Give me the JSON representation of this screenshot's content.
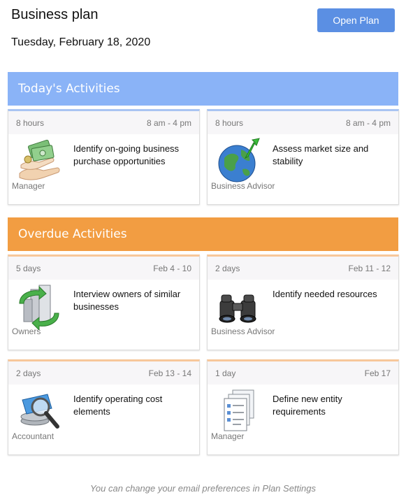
{
  "header": {
    "title": "Business plan",
    "date": "Tuesday, February 18, 2020",
    "open_button_label": "Open Plan"
  },
  "sections": {
    "today": {
      "label": "Today's Activities",
      "color": "#8ab3f7"
    },
    "overdue": {
      "label": "Overdue Activities",
      "color": "#f29d42"
    }
  },
  "cards": [
    {
      "duration": "8 hours",
      "timeframe": "8 am - 4 pm",
      "title": "Identify on-going business purchase opportunities",
      "role": "Manager",
      "icon": "money-hand-icon"
    },
    {
      "duration": "8 hours",
      "timeframe": "8 am - 4 pm",
      "title": "Assess market size and stability",
      "role": "Business Advisor",
      "icon": "globe-arrow-icon"
    },
    {
      "duration": "5 days",
      "timeframe": "Feb 4 - 10",
      "title": "Interview owners of similar businesses",
      "role": "Owners",
      "icon": "buildings-cycle-icon"
    },
    {
      "duration": "2 days",
      "timeframe": "Feb 11 - 12",
      "title": "Identify needed resources",
      "role": "Business Advisor",
      "icon": "binoculars-icon"
    },
    {
      "duration": "2 days",
      "timeframe": "Feb 13 - 14",
      "title": "Identify operating cost elements",
      "role": "Accountant",
      "icon": "magnifier-coins-icon"
    },
    {
      "duration": "1 day",
      "timeframe": "Feb 17",
      "title": "Define new entity requirements",
      "role": "Manager",
      "icon": "checklist-documents-icon"
    }
  ],
  "footer": {
    "text": "You can change your email preferences in Plan Settings"
  }
}
